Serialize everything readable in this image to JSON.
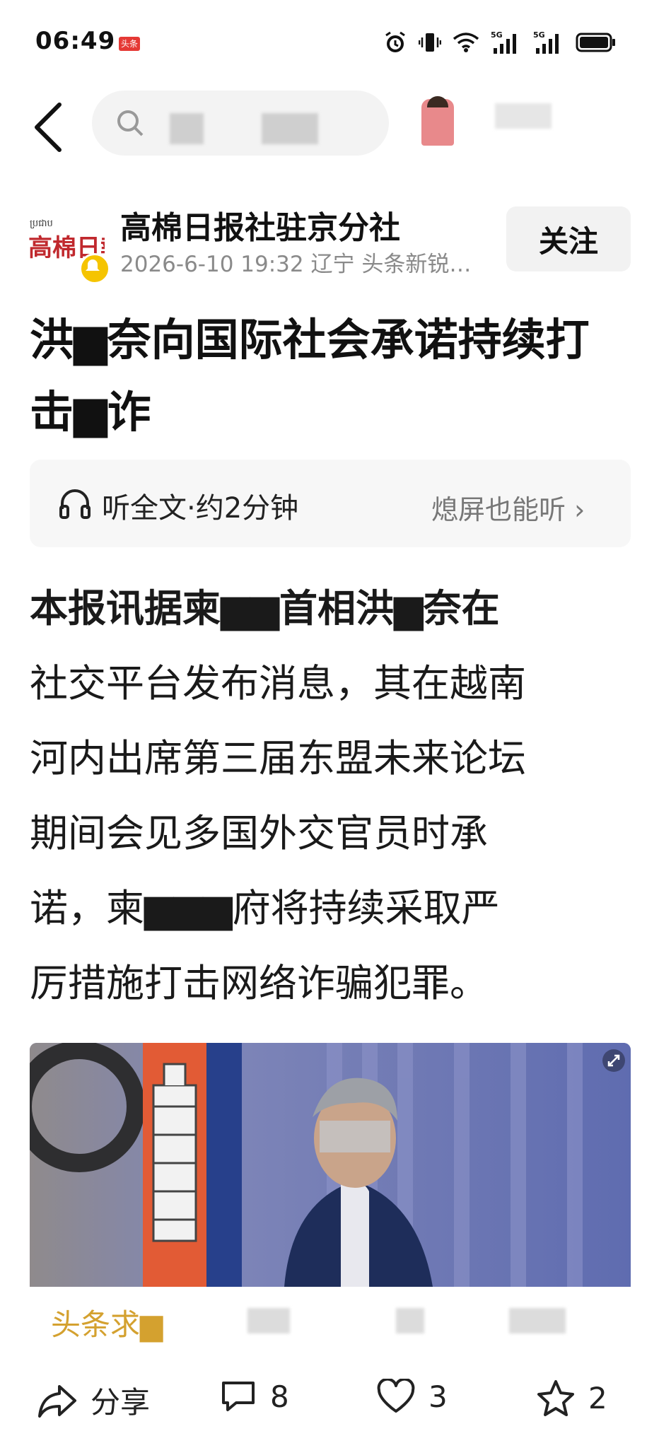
{
  "status_bar": {
    "time": "06:49",
    "app_badge": "头条",
    "icons": [
      "alarm-icon",
      "vibrate-icon",
      "wifi-icon",
      "signal-5g-icon",
      "signal-5g-icon",
      "battery-icon"
    ],
    "signal_label": "5G"
  },
  "nav": {
    "back_icon": "back-chevron-icon"
  },
  "author": {
    "name": "高棉日报社驻京分社",
    "meta": "2026-6-10  19:32  辽宁  头条新锐…",
    "follow_label": "关注"
  },
  "article": {
    "title_lines": [
      "洪▆奈向国际社会承诺持续打",
      "击▆诈"
    ],
    "listen": {
      "label": "听全文·约2分钟",
      "right": "熄屏也能听 ›"
    },
    "body_lines": [
      "本报讯据柬▆▆首相洪▆奈在",
      "社交平台发布消息，其在越南",
      "河内出席第三届东盟未来论坛",
      "期间会见多国外交官员时承",
      "诺，柬▆▆▆府将持续采取严",
      "厉措施打击网络诈骗犯罪。"
    ]
  },
  "suggestion": {
    "label": "头条求▆"
  },
  "bottom_bar": {
    "share_label": "分享",
    "comment_count": "8",
    "like_count": "3",
    "favorite_count": "2"
  },
  "colors": {
    "accent_gold": "#d4a12f",
    "follow_bg": "#f2f2f2",
    "meta_gray": "#8a8a8a"
  }
}
